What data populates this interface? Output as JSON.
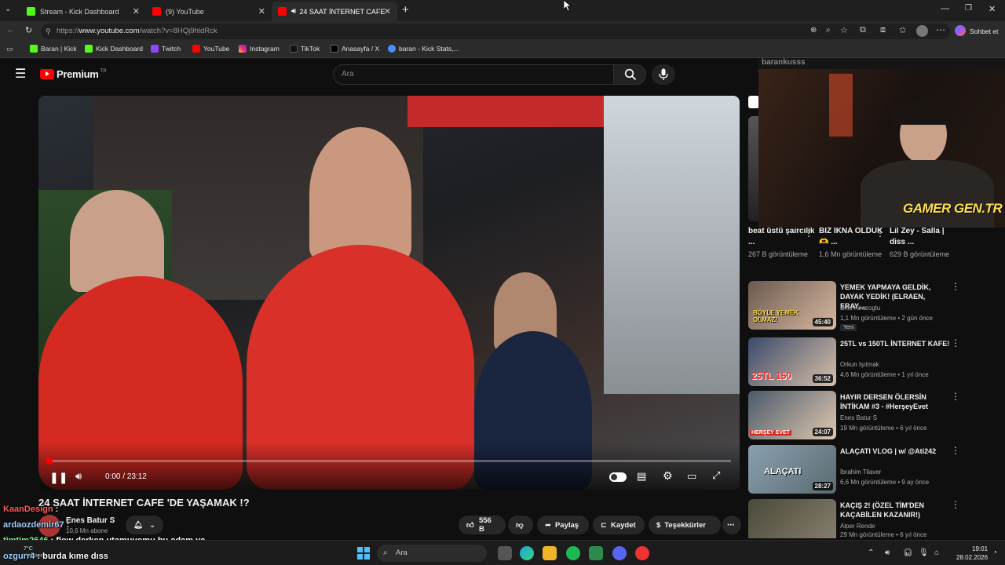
{
  "browser": {
    "tabs": [
      {
        "label": "Stream - Kick Dashboard",
        "active": false
      },
      {
        "label": "(9) YouTube",
        "active": false
      },
      {
        "label": "24 SAAT İNTERNET CAFE 'DE",
        "active": true
      }
    ],
    "url_prefix": "https://",
    "url_domain": "www.youtube.com",
    "url_path": "/watch?v=8HQj9hldRck",
    "copilot_label": "Sohbet et",
    "bookmarks": [
      "Baran | Kick",
      "Kick Dashboard",
      "Twitch",
      "YouTube",
      "Instagram",
      "TikTok",
      "Anasayfa / X",
      "baran - Kick Stats,..."
    ]
  },
  "youtube": {
    "logo": "Premium",
    "logo_region": "TR",
    "search_placeholder": "Ara",
    "player": {
      "time": "0:00 / 23:12",
      "progress": 0.005
    },
    "video_title": "24 SAAT İNTERNET CAFE 'DE YAŞAMAK !?",
    "channel": "Enes Batur S",
    "subscribers": "10,6 Mn abone",
    "actions": {
      "likes": "556 B",
      "share": "Paylaş",
      "save": "Kaydet",
      "thanks": "Teşekkürler"
    },
    "shorts": [
      {
        "title": "beat üstü şaircilik ...",
        "views": "267 B görüntüleme"
      },
      {
        "title": "BİZ İKNA OLDUK🫶 ...",
        "views": "1,6 Mn görüntüleme"
      },
      {
        "title": "Lil Zey - Salla | diss ...",
        "views": "629 B görüntüleme"
      }
    ],
    "recommendations": [
      {
        "title": "YEMEK YAPMAYA GELDİK, DAYAK YEDİK! (ELRAEN, ERAY,...",
        "channel": "Enis Kirazoglu",
        "meta": "1,1 Mn görüntüleme • 2 gün önce",
        "badge": "Yeni",
        "duration": "45:40",
        "thumb_text": "BÖYLE YEMEK OLMAZ!"
      },
      {
        "title": "25TL vs 150TL İNTERNET KAFE!",
        "channel": "Orkun Işıtmak",
        "meta": "4,6 Mn görüntüleme • 1 yıl önce",
        "duration": "36:52",
        "thumb_text": "25TL 150"
      },
      {
        "title": "HAYIR DERSEN ÖLERSİN İNTİKAM #3 - #HerşeyEvet",
        "channel": "Enes Batur S",
        "meta": "19 Mn görüntüleme • 6 yıl önce",
        "duration": "24:07",
        "thumb_text": "HERŞEY EVET"
      },
      {
        "title": "ALAÇATI VLOG | w/ @Ati242",
        "channel": "İbrahim Tilaver",
        "meta": "6,6 Mn görüntüleme • 9 ay önce",
        "duration": "28:27",
        "thumb_text": "ALAÇATI"
      },
      {
        "title": "KAÇIŞ 2! (ÖZEL TİM'DEN KAÇABİLEN KAZANIR!)",
        "channel": "Alper Rende",
        "meta": "29 Mn görüntüleme • 6 yıl önce",
        "duration": "",
        "thumb_text": ""
      }
    ]
  },
  "overlay": {
    "cam_handle": "barankusss",
    "cam_logo": "GAMER GEN.TR",
    "chat": [
      {
        "user": "KaanDesign",
        "color": "#ff5a5a",
        "msg": ":"
      },
      {
        "user": "ardaozdemir67",
        "color": "#9fd1ff",
        "msg": ":"
      },
      {
        "user": "timtim2646",
        "color": "#7cff8a",
        "msg": ": flow derken utamuyomu bu adam ya"
      },
      {
        "user": "ozgurr4",
        "color": "#9fd1ff",
        "msg": ": burda kıme dıss"
      }
    ]
  },
  "taskbar": {
    "search": "Ara",
    "weather_temp": "7°C",
    "weather_desc": "Yağmur",
    "time": "19:01",
    "date": "28.02.2026"
  },
  "colors": {
    "youtube_red": "#ff0000",
    "hoodie_red": "#d42a22",
    "kick_green": "#53fc18"
  }
}
